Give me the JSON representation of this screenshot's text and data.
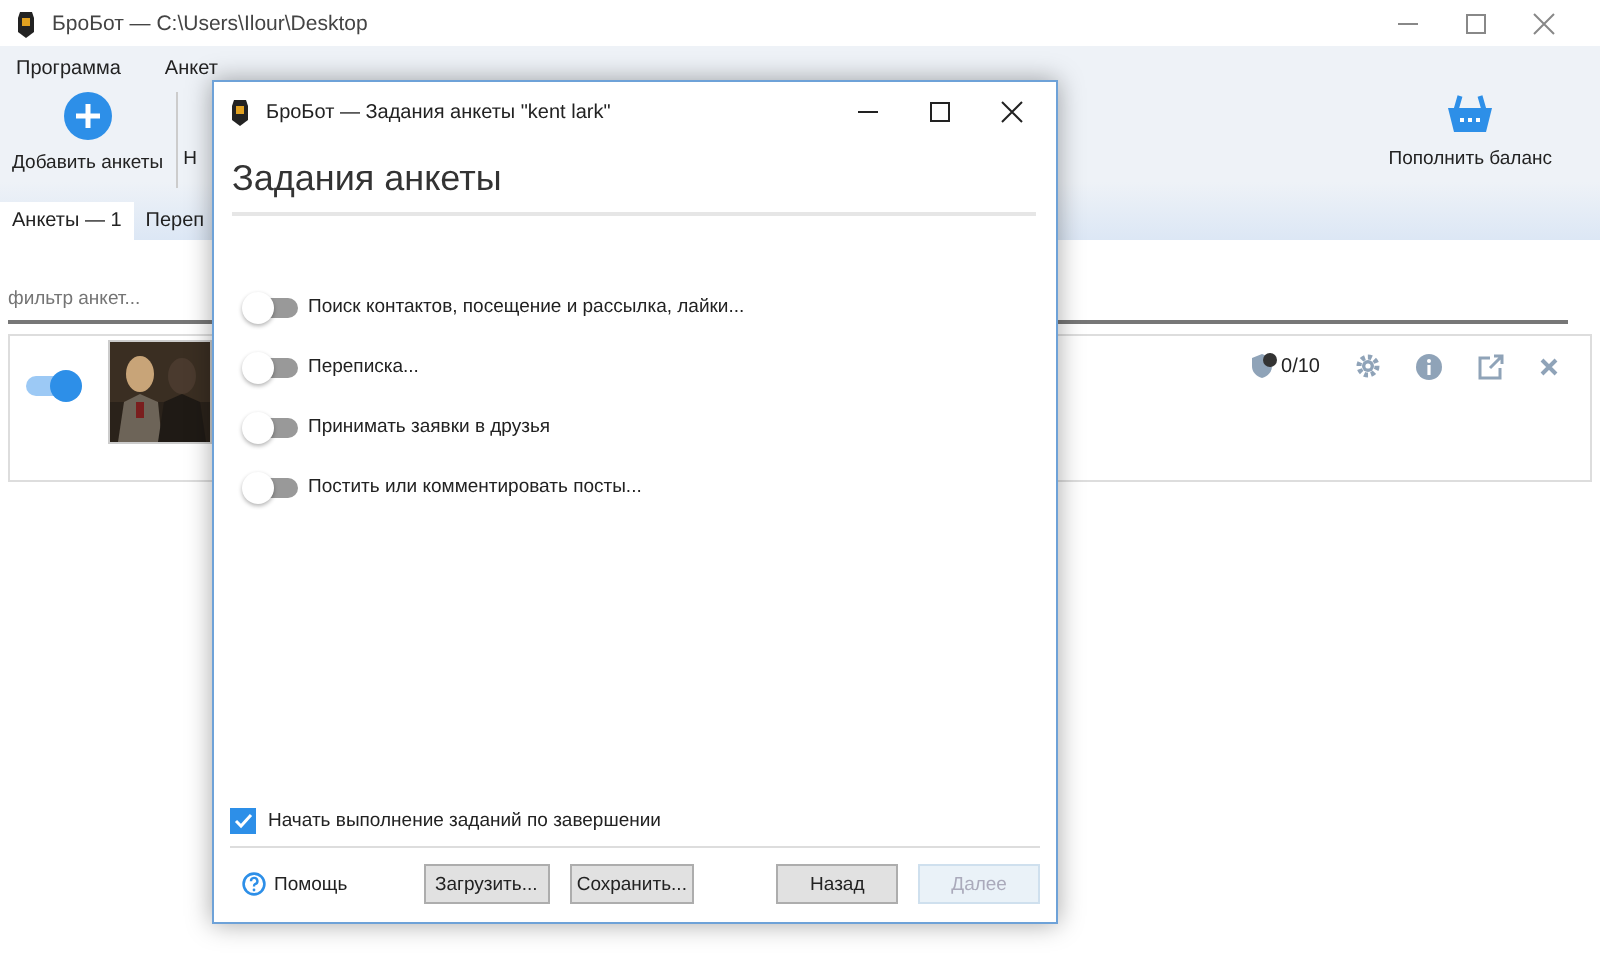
{
  "main": {
    "title": "БроБот — C:\\Users\\Ilour\\Desktop",
    "menu": [
      "Программа",
      "Анкет"
    ],
    "toolbar": [
      {
        "label": "Добавить анкеты"
      },
      {
        "label": "Н"
      }
    ],
    "balance": "Пополнить баланс",
    "tabs": [
      {
        "label": "Анкеты — 1",
        "selected": true
      },
      {
        "label": "Переп",
        "selected": false
      }
    ],
    "filter": {
      "placeholder": "фильтр анкет..."
    },
    "profiles": [
      {
        "on": true,
        "count": "0/10"
      }
    ]
  },
  "dialog": {
    "title": "БроБот — Задания анкеты \"kent lark\"",
    "heading": "Задания анкеты",
    "tasks": [
      {
        "label": "Поиск контактов, посещение и рассылка, лайки...",
        "on": false
      },
      {
        "label": "Переписка...",
        "on": false
      },
      {
        "label": "Принимать заявки в друзья",
        "on": false
      },
      {
        "label": "Постить или комментировать посты...",
        "on": false
      }
    ],
    "start_on_finish": {
      "label": "Начать выполнение заданий по завершении",
      "checked": true
    },
    "help": "Помощь",
    "buttons": [
      {
        "label": "Загрузить...",
        "disabled": false
      },
      {
        "label": "Сохранить...",
        "disabled": false
      },
      {
        "label": "Назад",
        "disabled": false
      },
      {
        "label": "Далее",
        "disabled": true
      }
    ]
  }
}
